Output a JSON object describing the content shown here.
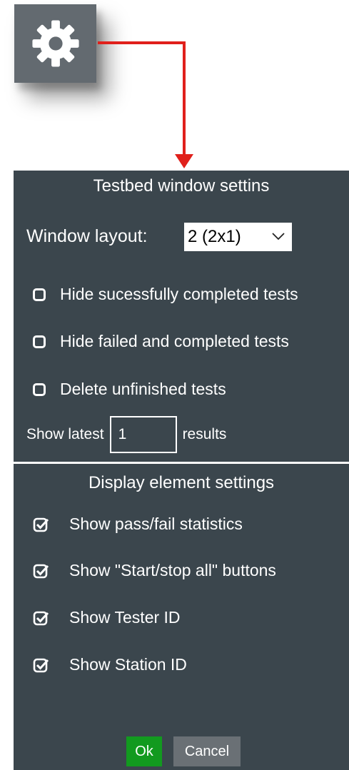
{
  "gear_button": {
    "icon": "gear-icon"
  },
  "panel": {
    "title": "Testbed window settins",
    "window_layout": {
      "label": "Window layout:",
      "value": "2 (2x1)"
    },
    "options": [
      {
        "label": "Hide sucessfully completed tests",
        "checked": false
      },
      {
        "label": "Hide failed and completed tests",
        "checked": false
      },
      {
        "label": "Delete unfinished tests",
        "checked": false
      }
    ],
    "show_latest": {
      "prefix": "Show latest",
      "value": "1",
      "suffix": "results"
    },
    "display_title": "Display element settings",
    "display_options": [
      {
        "label": "Show pass/fail statistics",
        "checked": true
      },
      {
        "label": "Show \"Start/stop all\" buttons",
        "checked": true
      },
      {
        "label": "Show Tester ID",
        "checked": true
      },
      {
        "label": "Show Station ID",
        "checked": true
      }
    ],
    "ok_label": "Ok",
    "cancel_label": "Cancel"
  },
  "colors": {
    "panel_bg": "#3b464d",
    "ok_bg": "#129a1f",
    "cancel_bg": "#6a7075",
    "arrow": "#e0201b",
    "gear_bg": "#636a70"
  }
}
